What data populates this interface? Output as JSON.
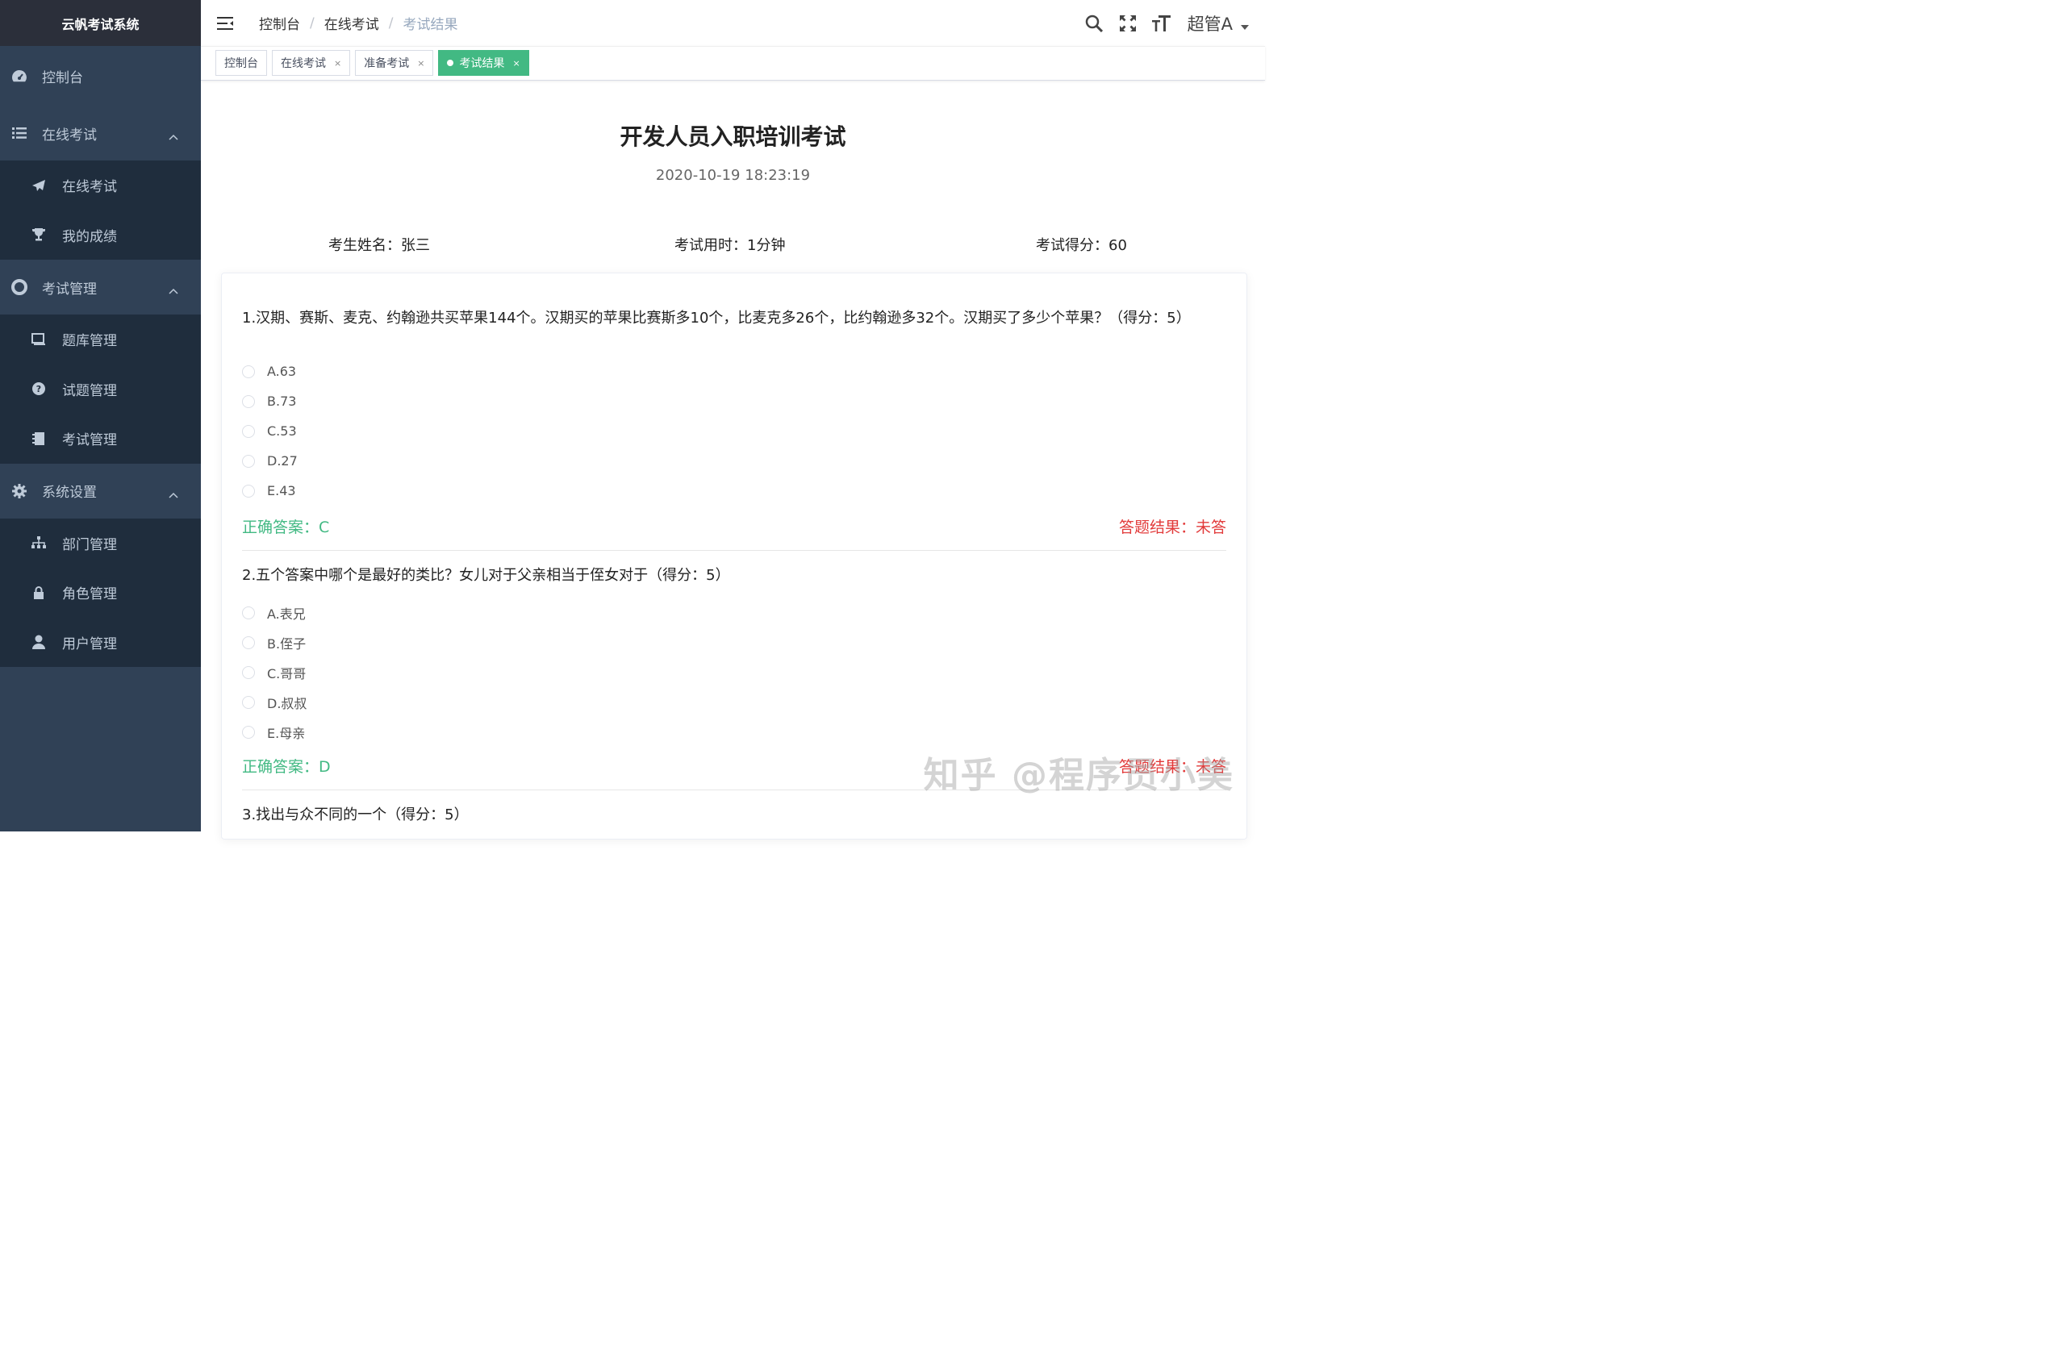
{
  "app": {
    "title": "云帆考试系统"
  },
  "sidebar": {
    "dashboard": "控制台",
    "groups": [
      {
        "label": "在线考试",
        "items": [
          "在线考试",
          "我的成绩"
        ]
      },
      {
        "label": "考试管理",
        "items": [
          "题库管理",
          "试题管理",
          "考试管理"
        ]
      },
      {
        "label": "系统设置",
        "items": [
          "部门管理",
          "角色管理",
          "用户管理"
        ]
      }
    ]
  },
  "breadcrumb": [
    "控制台",
    "在线考试",
    "考试结果"
  ],
  "breadcrumb_sep": "/",
  "user": {
    "name": "超管A"
  },
  "tags": [
    {
      "label": "控制台",
      "closable": false,
      "active": false
    },
    {
      "label": "在线考试",
      "closable": true,
      "active": false
    },
    {
      "label": "准备考试",
      "closable": true,
      "active": false
    },
    {
      "label": "考试结果",
      "closable": true,
      "active": true
    }
  ],
  "tag_close": "×",
  "exam": {
    "title": "开发人员入职培训考试",
    "time": "2020-10-19 18:23:19",
    "student": "考生姓名：张三",
    "duration": "考试用时：1分钟",
    "score": "考试得分：60"
  },
  "questions": [
    {
      "text": "1.汉期、赛斯、麦克、约翰逊共买苹果144个。汉期买的苹果比赛斯多10个，比麦克多26个，比约翰逊多32个。汉期买了多少个苹果？（得分：5）",
      "options": [
        "A.63",
        "B.73",
        "C.53",
        "D.27",
        "E.43"
      ],
      "correct": "正确答案：C",
      "result": "答题结果：未答"
    },
    {
      "text": "2.五个答案中哪个是最好的类比？女儿对于父亲相当于侄女对于（得分：5）",
      "options": [
        "A.表兄",
        "B.侄子",
        "C.哥哥",
        "D.叔叔",
        "E.母亲"
      ],
      "correct": "正确答案：D",
      "result": "答题结果：未答"
    },
    {
      "text": "3.找出与众不同的一个（得分：5）"
    }
  ],
  "watermark": "知乎 @程序员小美",
  "colors": {
    "sidebar": "#304156",
    "submenu": "#1f2d3d",
    "accent": "#42b983",
    "error": "#e23a3a"
  }
}
